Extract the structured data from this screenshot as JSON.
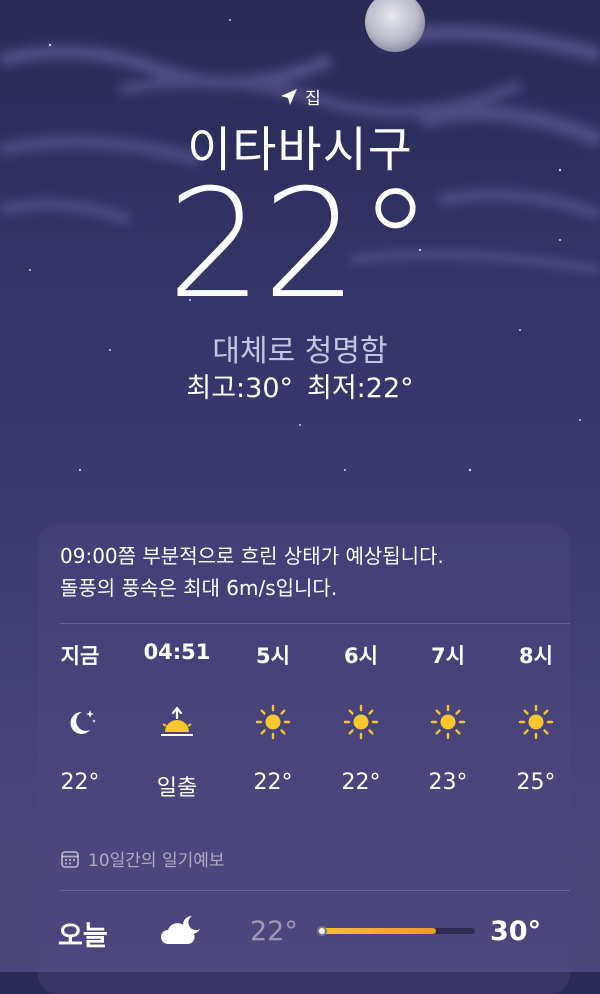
{
  "location": {
    "tag_label": "집",
    "tag_icon": "location-arrow-icon",
    "city": "이타바시구"
  },
  "current": {
    "temperature": "22°",
    "condition": "대체로 청명함",
    "high": "최고:30°",
    "low": "최저:22°"
  },
  "hourly_card": {
    "summary_line1": "09:00쯤 부분적으로 흐린 상태가 예상됩니다.",
    "summary_line2": "돌풍의 풍속은 최대 6m/s입니다.",
    "hours": [
      {
        "label": "지금",
        "icon": "moon-stars-icon",
        "value": "22°"
      },
      {
        "label": "04:51",
        "icon": "sunrise-icon",
        "value": "일출"
      },
      {
        "label": "5시",
        "icon": "sun-icon",
        "value": "22°"
      },
      {
        "label": "6시",
        "icon": "sun-icon",
        "value": "22°"
      },
      {
        "label": "7시",
        "icon": "sun-icon",
        "value": "23°"
      },
      {
        "label": "8시",
        "icon": "sun-icon",
        "value": "25°"
      }
    ]
  },
  "ten_day": {
    "title": "10일간의 일기예보",
    "icon": "calendar-icon",
    "today": {
      "day": "오늘",
      "icon": "cloud-moon-icon",
      "low": "22°",
      "high": "30°",
      "range_fill_fraction": 0.75
    }
  },
  "colors": {
    "sun": "#f7c72b",
    "range_start": "#f5c13a",
    "range_end": "#f29a20",
    "condition_text": "#c6c6e4"
  }
}
